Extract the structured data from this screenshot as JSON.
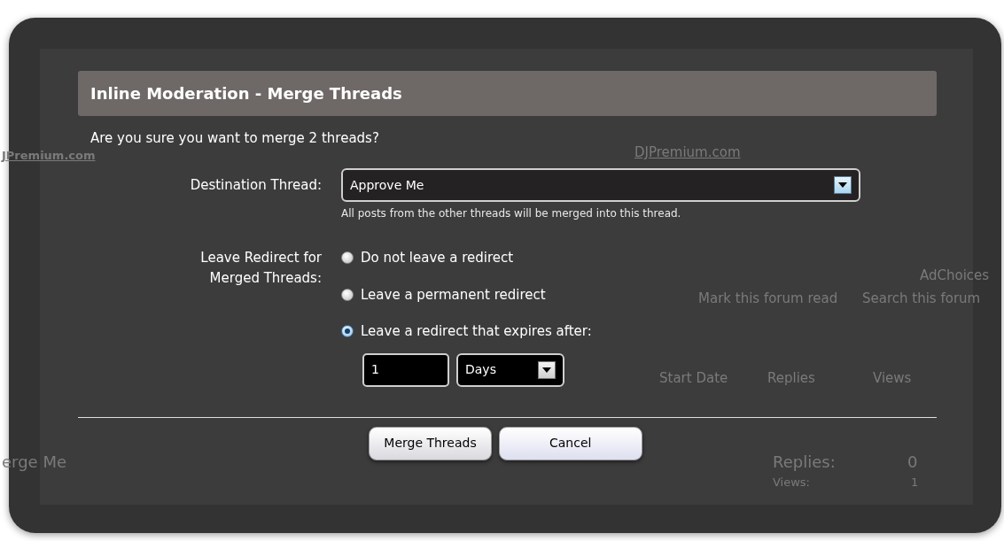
{
  "background": {
    "ad_link_left": "JPremium.com",
    "ad_link_right": "DJPremium.com",
    "ad_choices": "AdChoices",
    "forum_links": [
      "Mark this forum read",
      "Search this forum"
    ],
    "columns": [
      "Start Date",
      "Replies",
      "Views"
    ],
    "thread": {
      "title": "erge Me",
      "replies_label": "Replies:",
      "replies": "0",
      "views_label": "Views:",
      "views": "1"
    }
  },
  "dialog": {
    "title": "Inline Moderation - Merge Threads",
    "question": "Are you sure you want to merge 2 threads?",
    "destination": {
      "label": "Destination Thread:",
      "value": "Approve Me",
      "hint": "All posts from the other threads will be merged into this thread."
    },
    "redirect": {
      "label_lines": [
        "Leave Redirect for",
        "Merged Threads:"
      ],
      "options": [
        {
          "label": "Do not leave a redirect",
          "selected": false
        },
        {
          "label": "Leave a permanent redirect",
          "selected": false
        },
        {
          "label": "Leave a redirect that expires after:",
          "selected": true
        }
      ],
      "expiry": {
        "amount": "1",
        "unit": "Days"
      }
    },
    "buttons": [
      {
        "label": "Merge Threads",
        "kind": "primary"
      },
      {
        "label": "Cancel",
        "kind": "secondary"
      }
    ]
  }
}
